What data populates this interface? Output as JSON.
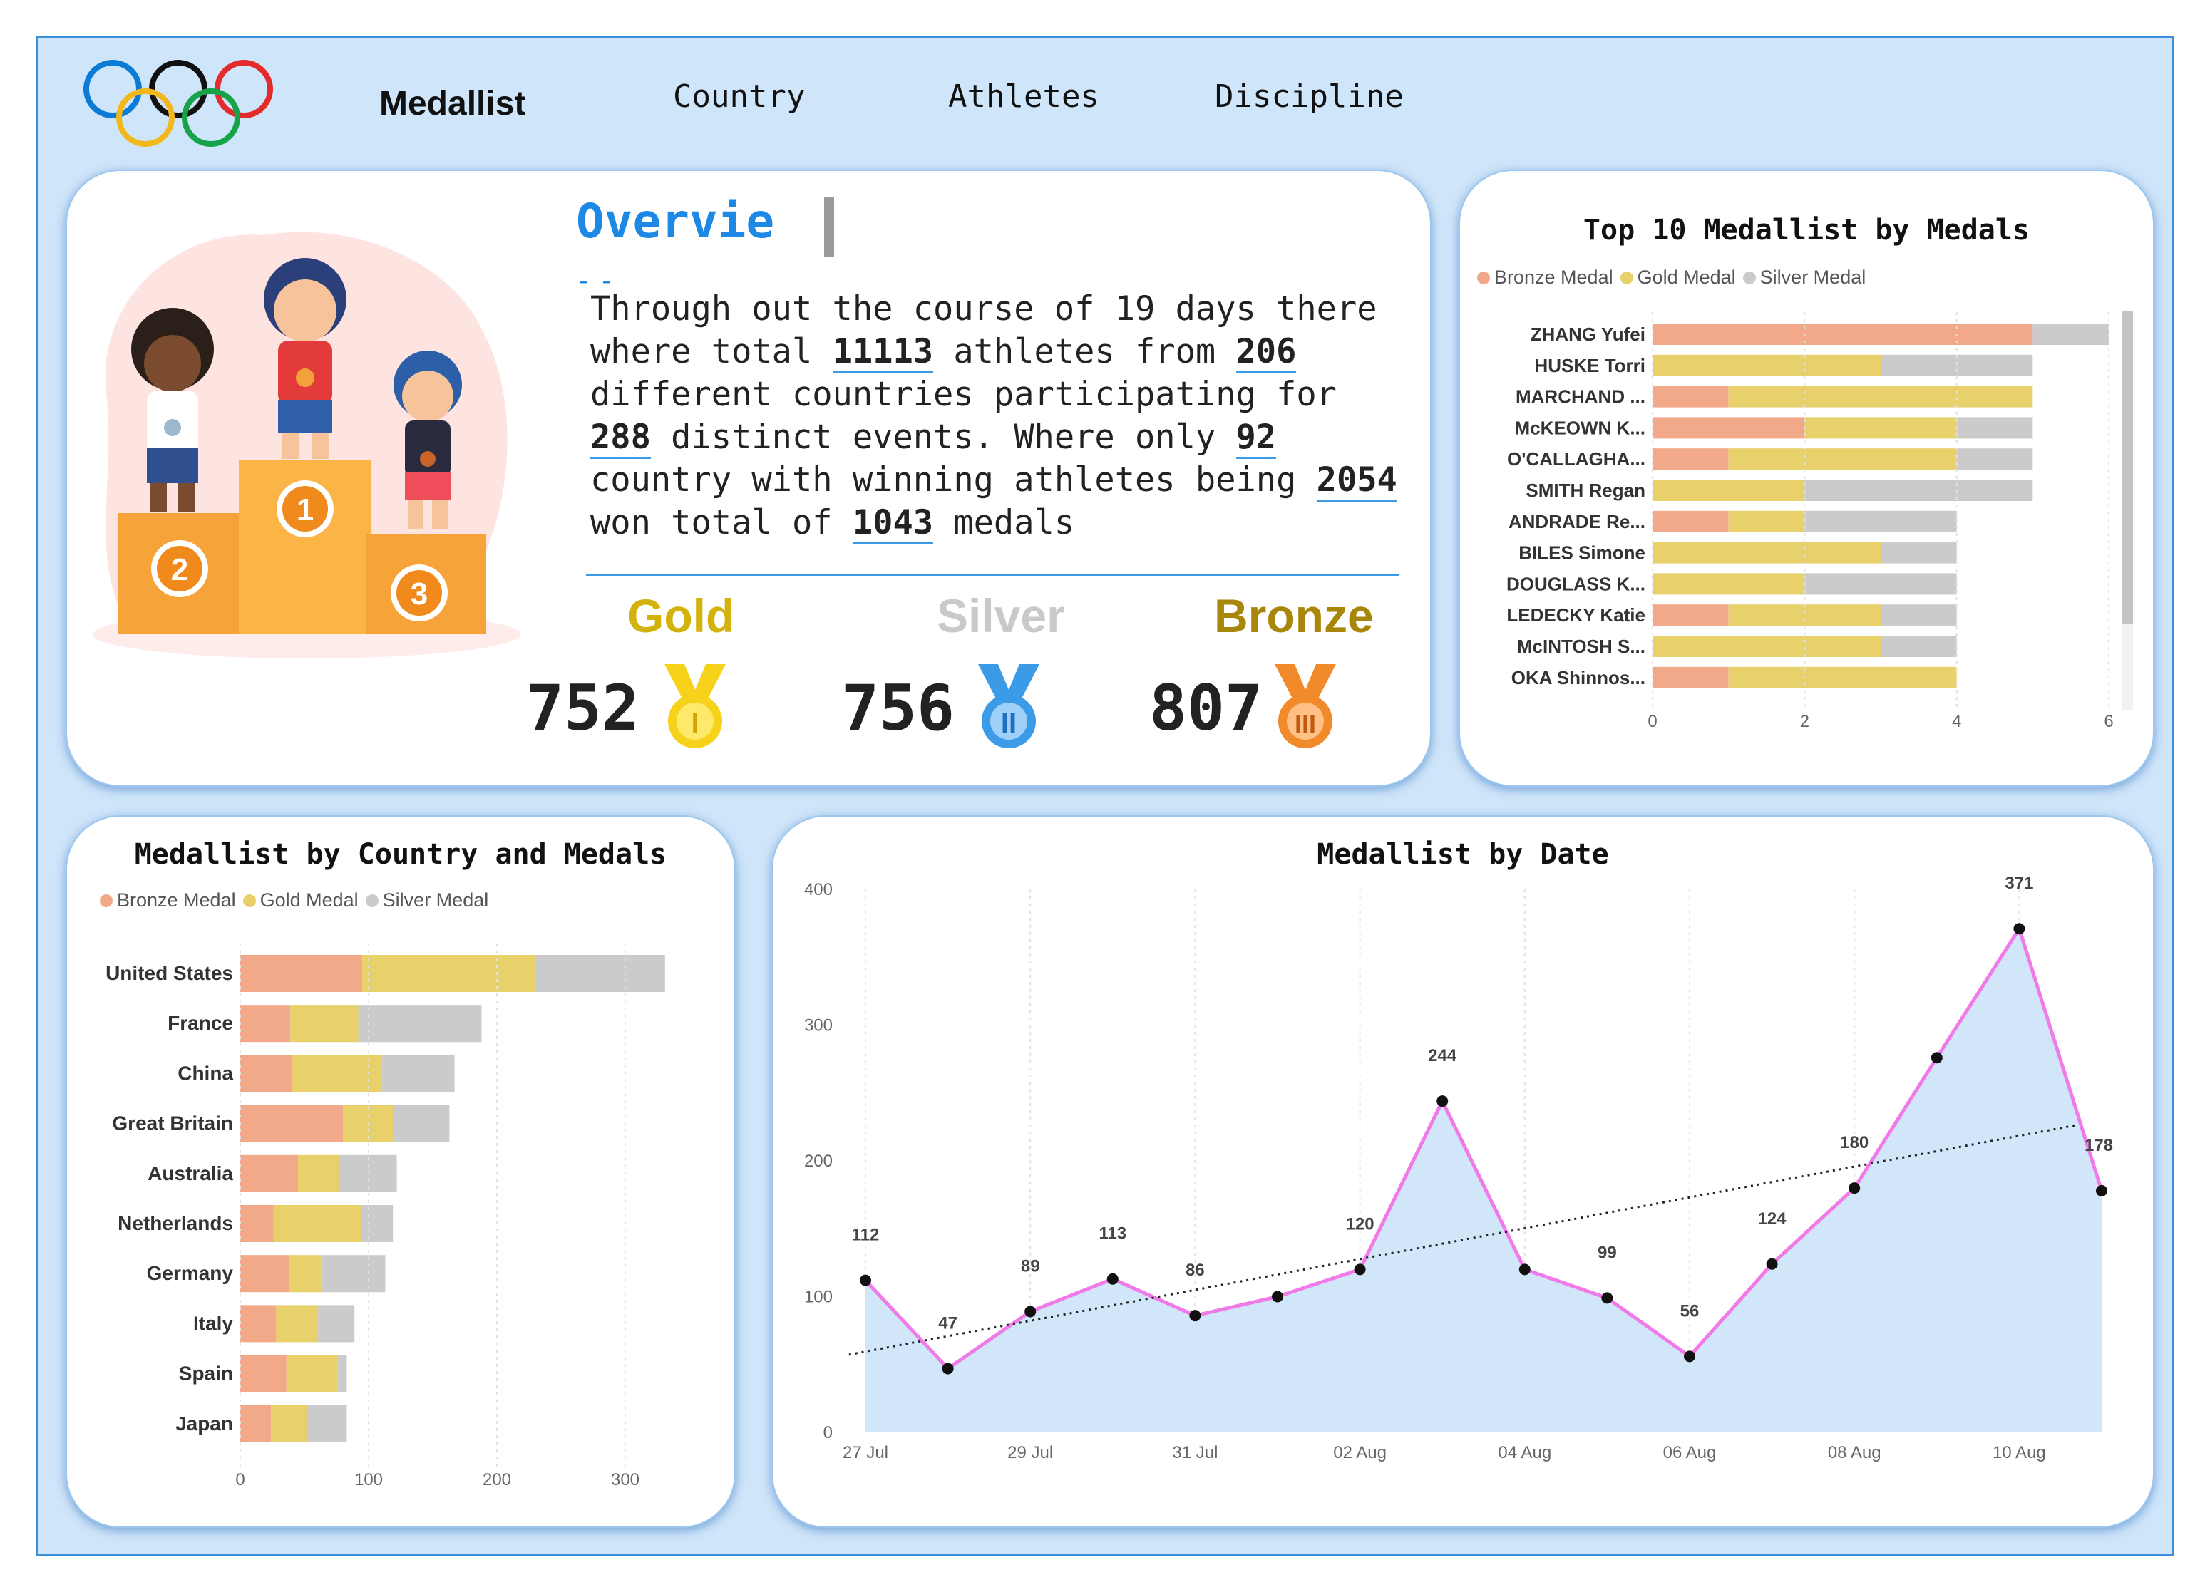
{
  "nav": {
    "items": [
      "Medallist",
      "Country",
      "Athletes",
      "Discipline"
    ],
    "active": 0
  },
  "overview": {
    "title": "Overvie",
    "text_parts": [
      {
        "t": "Through out the course of 19 days there where total "
      },
      {
        "t": "11113",
        "b": true
      },
      {
        "t": " athletes from "
      },
      {
        "t": "206",
        "b": true
      },
      {
        "t": " different countries participating for "
      },
      {
        "t": "288",
        "b": true
      },
      {
        "t": " distinct events. Where only "
      },
      {
        "t": "92",
        "b": true
      },
      {
        "t": " country with winning athletes being "
      },
      {
        "t": "2054",
        "b": true
      },
      {
        "t": " won total of "
      },
      {
        "t": "1043",
        "b": true
      },
      {
        "t": " medals"
      }
    ],
    "medals": [
      {
        "label": "Gold",
        "value": "752",
        "color": "#d4b20c",
        "icon": "gold-medal-icon"
      },
      {
        "label": "Silver",
        "value": "756",
        "color": "#c9c9c9",
        "icon": "silver-medal-icon"
      },
      {
        "label": "Bronze",
        "value": "807",
        "color": "#a8860a",
        "icon": "bronze-medal-icon"
      }
    ]
  },
  "colors": {
    "bronze": "#f2a98a",
    "gold": "#e8d06a",
    "silver": "#cbcbcb",
    "accent": "#1e88e5",
    "line": "#f07be8",
    "area": "#cfe5f9"
  },
  "chart_data": [
    {
      "type": "bar",
      "title": "Top 10 Medallist by Medals",
      "orientation": "horizontal-stacked",
      "legend": [
        "Bronze Medal",
        "Gold Medal",
        "Silver Medal"
      ],
      "categories": [
        "ZHANG Yufei",
        "HUSKE Torri",
        "MARCHAND ...",
        "McKEOWN K...",
        "O'CALLAGHA...",
        "SMITH Regan",
        "ANDRADE Re...",
        "BILES Simone",
        "DOUGLASS K...",
        "LEDECKY Katie",
        "McINTOSH S...",
        "OKA Shinnos..."
      ],
      "series": [
        {
          "name": "Bronze Medal",
          "values": [
            5,
            0,
            1,
            2,
            1,
            0,
            1,
            0,
            0,
            1,
            0,
            1
          ]
        },
        {
          "name": "Gold Medal",
          "values": [
            0,
            3,
            4,
            2,
            3,
            2,
            1,
            3,
            2,
            2,
            3,
            3
          ]
        },
        {
          "name": "Silver Medal",
          "values": [
            1,
            2,
            0,
            1,
            1,
            3,
            2,
            1,
            2,
            1,
            1,
            0
          ]
        }
      ],
      "xticks": [
        "0",
        "2",
        "4",
        "6"
      ],
      "xlim": [
        0,
        6
      ]
    },
    {
      "type": "bar",
      "title": "Medallist by Country and Medals",
      "orientation": "horizontal-stacked",
      "legend": [
        "Bronze Medal",
        "Gold Medal",
        "Silver Medal"
      ],
      "categories": [
        "United States",
        "France",
        "China",
        "Great Britain",
        "Australia",
        "Netherlands",
        "Germany",
        "Italy",
        "Spain",
        "Japan"
      ],
      "series": [
        {
          "name": "Bronze Medal",
          "values": [
            95,
            39,
            40,
            80,
            45,
            26,
            38,
            28,
            36,
            24
          ]
        },
        {
          "name": "Gold Medal",
          "values": [
            135,
            53,
            70,
            40,
            32,
            68,
            25,
            32,
            40,
            28
          ]
        },
        {
          "name": "Silver Medal",
          "values": [
            101,
            96,
            57,
            43,
            45,
            25,
            50,
            29,
            7,
            31
          ]
        }
      ],
      "xticks": [
        "0",
        "100",
        "200",
        "300"
      ],
      "xlim": [
        0,
        345
      ]
    },
    {
      "type": "area",
      "title": "Medallist by Date",
      "x": [
        "27 Jul",
        "28 Jul",
        "29 Jul",
        "30 Jul",
        "31 Jul",
        "01 Aug",
        "02 Aug",
        "03 Aug",
        "04 Aug",
        "05 Aug",
        "06 Aug",
        "07 Aug",
        "08 Aug",
        "09 Aug",
        "10 Aug",
        "11 Aug"
      ],
      "values": [
        112,
        47,
        89,
        113,
        86,
        100,
        120,
        244,
        120,
        99,
        56,
        124,
        180,
        276,
        371,
        178
      ],
      "data_labels": [
        "112",
        "47",
        "89",
        "113",
        "86",
        "",
        "120",
        "244",
        "",
        "99",
        "56",
        "124",
        "180",
        "",
        "371",
        "178"
      ],
      "xticks": [
        "27 Jul",
        "29 Jul",
        "31 Jul",
        "02 Aug",
        "04 Aug",
        "06 Aug",
        "08 Aug",
        "10 Aug"
      ],
      "yticks": [
        "0",
        "100",
        "200",
        "300",
        "400"
      ],
      "ylim": [
        0,
        400
      ],
      "trendline": true,
      "grid": "vertical dotted"
    }
  ]
}
